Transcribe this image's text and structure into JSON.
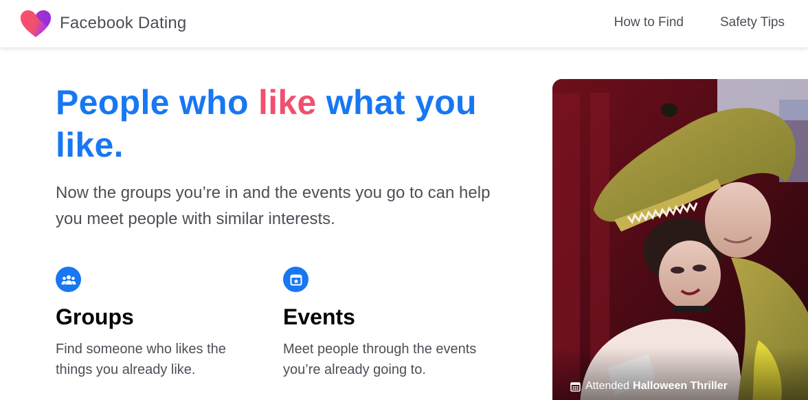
{
  "header": {
    "brand": "Facebook Dating",
    "logo_icon": "heart-logo-icon",
    "nav": [
      {
        "label": "How to Find"
      },
      {
        "label": "Safety Tips"
      }
    ]
  },
  "hero": {
    "headline_part1": "People who ",
    "headline_accent": "like",
    "headline_part2": " what you like.",
    "subtitle": "Now the groups you’re in and the events you go to can help you meet people with similar interests."
  },
  "features": {
    "groups": {
      "icon": "groups-icon",
      "title": "Groups",
      "description": "Find someone who likes the things you already like."
    },
    "events": {
      "icon": "event-star-icon",
      "title": "Events",
      "description": "Meet people through the events you’re already going to."
    }
  },
  "photo_card": {
    "caption_prefix": "Attended",
    "caption_event": "Halloween Thriller",
    "caption_icon": "calendar-icon"
  },
  "colors": {
    "primary": "#1877f2",
    "accent": "#f0506e",
    "text_muted": "#4b4f56"
  }
}
